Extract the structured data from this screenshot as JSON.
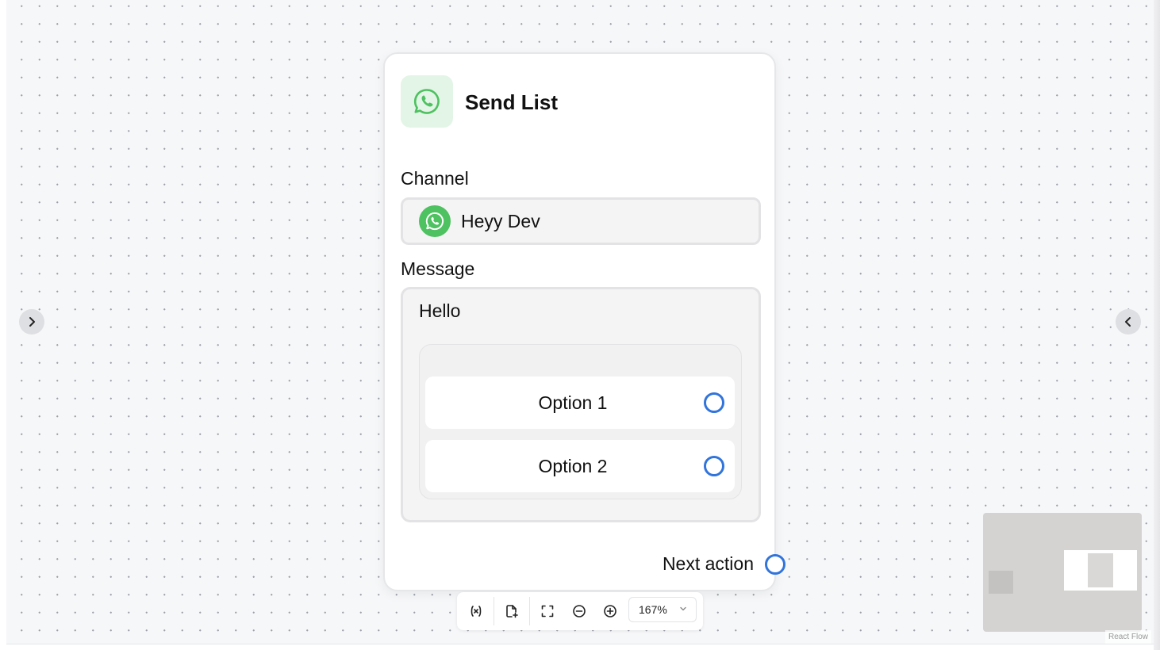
{
  "node": {
    "title": "Send List",
    "icon": "whatsapp-icon",
    "channel_label": "Channel",
    "channel_name": "Heyy Dev",
    "message_label": "Message",
    "message_text": "Hello",
    "options": [
      {
        "label": "Option 1"
      },
      {
        "label": "Option 2"
      }
    ],
    "next_action_label": "Next action"
  },
  "toolbar": {
    "zoom_value": "167%",
    "buttons": [
      "variables-icon",
      "add-file-icon",
      "fit-view-icon",
      "zoom-out-icon",
      "zoom-in-icon"
    ]
  },
  "sidebar_toggles": {
    "left": "chevron-right-icon",
    "right": "chevron-left-icon"
  },
  "attribution": "React Flow",
  "colors": {
    "handle": "#3174db",
    "whatsapp_green": "#4ec160",
    "icon_bg": "#e3f5e6"
  }
}
